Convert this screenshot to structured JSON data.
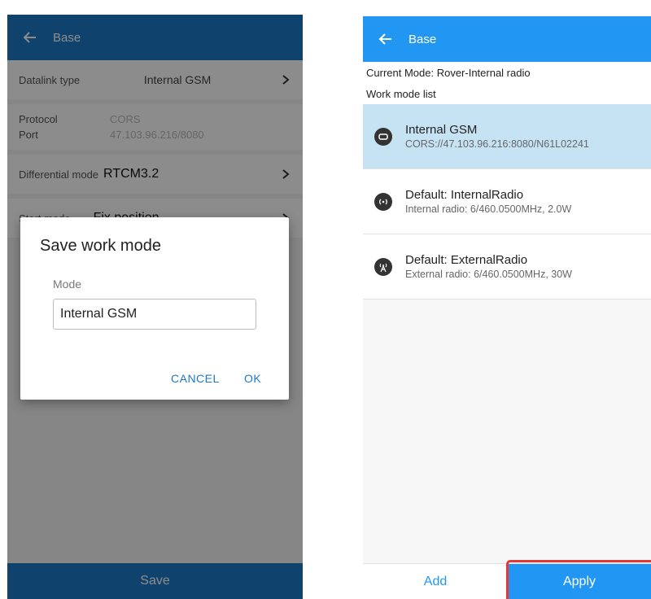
{
  "left": {
    "header": {
      "title": "Base"
    },
    "datalink": {
      "label": "Datalink type",
      "value": "Internal GSM"
    },
    "protocol": {
      "label": "Protocol",
      "value": "CORS"
    },
    "port": {
      "label": "Port",
      "value": "47.103.96.216/8080"
    },
    "differential": {
      "label": "Differential mode",
      "value": "RTCM3.2"
    },
    "start_mode": {
      "label": "Start mode",
      "value": "Fix position"
    },
    "save_label": "Save",
    "dialog": {
      "title": "Save work mode",
      "field_label": "Mode",
      "field_value": "Internal GSM",
      "cancel": "CANCEL",
      "ok": "OK"
    }
  },
  "right": {
    "header": {
      "title": "Base"
    },
    "current_mode": "Current Mode:  Rover-Internal radio",
    "list_heading": "Work mode list",
    "modes": [
      {
        "name": "Internal GSM",
        "desc": "CORS://47.103.96.216:8080/N61L02241",
        "icon": "gsm-icon"
      },
      {
        "name": "Default: InternalRadio",
        "desc": "Internal radio: 6/460.0500MHz, 2.0W",
        "icon": "internal-radio-icon"
      },
      {
        "name": "Default: ExternalRadio",
        "desc": "External radio: 6/460.0500MHz, 30W",
        "icon": "external-radio-icon"
      }
    ],
    "add_label": "Add",
    "apply_label": "Apply"
  },
  "colors": {
    "appbar": "#1e78c8",
    "accent": "#2196f3",
    "selected_row": "#c6e3f4",
    "highlight": "#e53935"
  }
}
